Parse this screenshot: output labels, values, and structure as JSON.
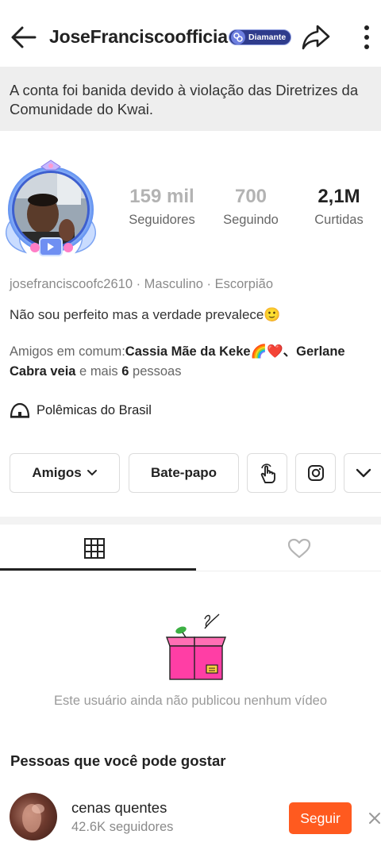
{
  "header": {
    "title": "JoseFranciscoofficial",
    "badge_label": "Diamante"
  },
  "notice": {
    "text": "A conta foi banida devido à violação das Diretrizes da Comunidade do Kwai."
  },
  "stats": {
    "followers_value": "159 mil",
    "followers_label": "Seguidores",
    "following_value": "700",
    "following_label": "Seguindo",
    "likes_value": "2,1M",
    "likes_label": "Curtidas"
  },
  "profile": {
    "info_line": "josefranciscoofc2610 · Masculino · Escorpião",
    "bio": "Não sou perfeito mas a verdade prevalece🙂",
    "friends_prefix": "Amigos em comum:",
    "friends_names": "Cassia Mãe da Keke🌈❤️、Gerlane Cabra veia",
    "friends_middle": " e mais ",
    "friends_count": "6",
    "friends_suffix": " pessoas",
    "group": "Polêmicas do Brasil"
  },
  "actions": {
    "friends_label": "Amigos",
    "chat_label": "Bate-papo"
  },
  "content": {
    "empty_text": "Este usuário ainda não publicou nenhum vídeo"
  },
  "suggestions": {
    "title": "Pessoas que você pode gostar",
    "items": [
      {
        "name": "cenas quentes",
        "followers": "42.6K seguidores",
        "follow_label": "Seguir"
      }
    ]
  },
  "colors": {
    "follow_button": "#ff5a1f",
    "badge_bg": "#2f3c8c",
    "notice_bg": "#eeeeee"
  }
}
